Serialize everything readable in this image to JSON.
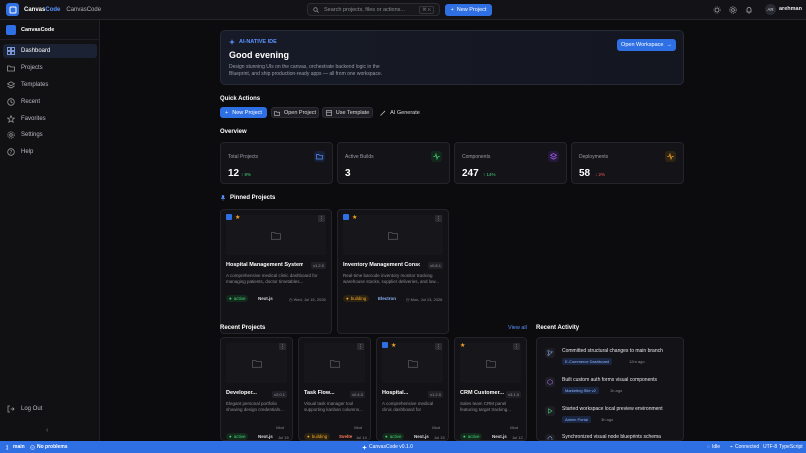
{
  "topbar": {
    "brand_a": "Canvas",
    "brand_b": "Code",
    "crumb": "CanvasCode",
    "search_placeholder": "Search projects, files or actions...",
    "search_kbd": "⌘ K",
    "new_project": "New Project",
    "avatar_initials": "AR",
    "username": "arehman"
  },
  "sidebar": {
    "brand": "CanvasCode",
    "items": [
      {
        "label": "Dashboard",
        "icon": "grid-icon"
      },
      {
        "label": "Projects",
        "icon": "folder-icon"
      },
      {
        "label": "Templates",
        "icon": "layers-icon"
      },
      {
        "label": "Recent",
        "icon": "clock-icon"
      },
      {
        "label": "Favorites",
        "icon": "star-icon"
      },
      {
        "label": "Settings",
        "icon": "gear-icon"
      },
      {
        "label": "Help",
        "icon": "help-icon"
      }
    ],
    "logout": "Log Out"
  },
  "hero": {
    "tag": "AI-NATIVE IDE",
    "greeting": "Good evening",
    "description": "Design stunning UIs on the canvas, orchestrate backend logic in the Blueprint, and ship production-ready apps — all from one workspace.",
    "open_workspace": "Open Workspace"
  },
  "quick_actions": {
    "title": "Quick Actions",
    "new_project": "New Project",
    "open_project": "Open Project",
    "use_template": "Use Template",
    "ai_generate": "AI Generate"
  },
  "overview": {
    "title": "Overview",
    "stats": [
      {
        "label": "Total Projects",
        "value": "12",
        "delta": "8%",
        "trend": "up",
        "color": "#5b93ff"
      },
      {
        "label": "Active Builds",
        "value": "3",
        "delta": "",
        "trend": "",
        "color": "#43d17a"
      },
      {
        "label": "Components",
        "value": "247",
        "delta": "14%",
        "trend": "up",
        "color": "#b06bff"
      },
      {
        "label": "Deployments",
        "value": "58",
        "delta": "2%",
        "trend": "down",
        "color": "#f5a623"
      }
    ]
  },
  "pinned": {
    "title": "Pinned Projects",
    "projects": [
      {
        "name": "Hospital Management System",
        "version": "v1.2.0",
        "desc": "A comprehensive medical clinic dashboard for managing patients, doctor timetables...",
        "status": "active",
        "tech": "Next.js",
        "tech2": "",
        "date": "Wed, Jul 15, 2026"
      },
      {
        "name": "Inventory Management Console",
        "version": "v0.8.1",
        "desc": "Real-time barcode inventory monitor tracking warehouse stocks, supplier deliveries, and low...",
        "status": "building",
        "tech": "Electron",
        "tech2": "",
        "date": "Mon, Jul 13, 2026"
      }
    ]
  },
  "recent_projects": {
    "title": "Recent Projects",
    "view_all": "View all",
    "projects": [
      {
        "name": "Developer...",
        "version": "v2.0.1",
        "desc": "Elegant personal portfolio showing design credentials...",
        "status": "active",
        "tech": "Next.js",
        "date": "Jul 15",
        "author": "Mod",
        "pinned": false
      },
      {
        "name": "Task Flow...",
        "version": "v0.4.0",
        "desc": "Visual task manager tool supporting kanban columns...",
        "status": "building",
        "tech": "Svelte",
        "date": "Jul 14",
        "author": "Mod",
        "pinned": false
      },
      {
        "name": "Hospital...",
        "version": "v1.2.0",
        "desc": "A comprehensive medical clinic dashboard for managin...",
        "status": "active",
        "tech": "Next.js",
        "date": "Jul 15",
        "author": "Mod",
        "pinned": true
      },
      {
        "name": "CRM Customer...",
        "version": "v3.1.0",
        "desc": "Sales team CRM panel featuring target tracking...",
        "status": "active",
        "tech": "Next.js",
        "date": "Jul 12",
        "author": "Mod",
        "pinned": false
      }
    ]
  },
  "recent_activity": {
    "title": "Recent Activity",
    "items": [
      {
        "text": "Committed structural changes to main branch",
        "tag": "E-Commerce Dashboard",
        "time": "12m ago",
        "icon": "git-branch-icon",
        "color": "#8fb4ff"
      },
      {
        "text": "Built custom auth forms visual components",
        "tag": "Marketing Site v2",
        "time": "1h ago",
        "icon": "box-icon",
        "color": "#b06bff"
      },
      {
        "text": "Started workspace local preview environment",
        "tag": "Admin Portal",
        "time": "3h ago",
        "icon": "play-icon",
        "color": "#43d17a"
      },
      {
        "text": "Synchronized visual node blueprints schema",
        "tag": "",
        "time": "",
        "icon": "sync-icon",
        "color": "#8fb4ff"
      }
    ]
  },
  "statusbar": {
    "branch": "main",
    "problems": "No problems",
    "version": "CanvasCode v0.1.0",
    "idle": "Idle",
    "connected": "Connected",
    "encoding": "UTF-8",
    "language": "TypeScript"
  }
}
